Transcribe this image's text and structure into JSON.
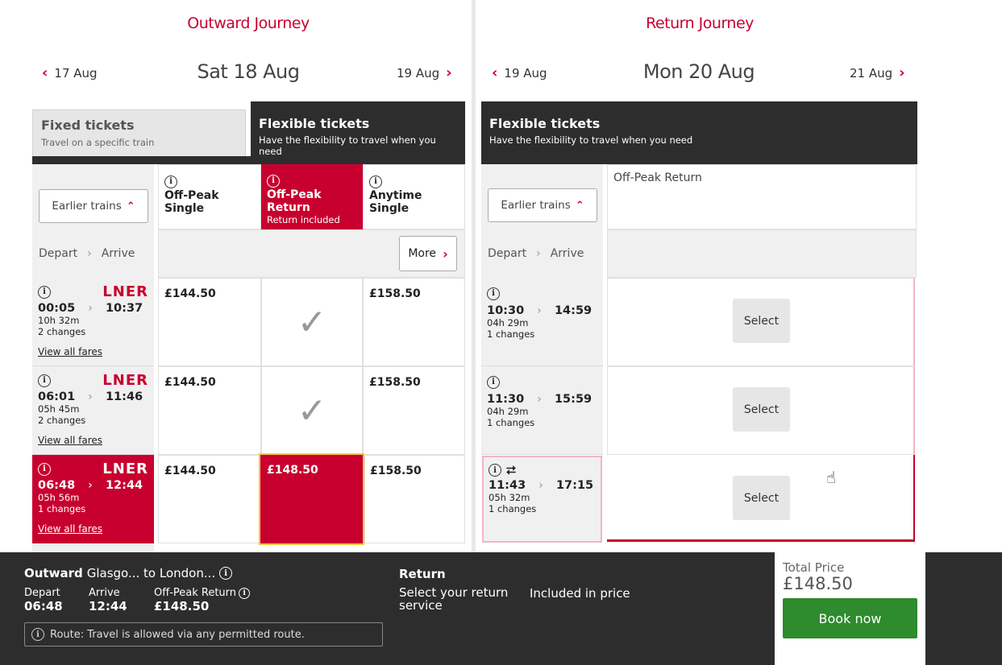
{
  "outward": {
    "title": "Outward Journey",
    "prev_date": "17 Aug",
    "current_date": "Sat 18 Aug",
    "next_date": "19 Aug",
    "tabs": {
      "fixed_title": "Fixed tickets",
      "fixed_sub": "Travel on a specific train",
      "flex_title": "Flexible tickets",
      "flex_sub": "Have the flexibility to travel when you need"
    },
    "earlier_label": "Earlier trains",
    "depart_label": "Depart",
    "arrive_label": "Arrive",
    "more_label": "More",
    "fares": [
      {
        "name": "Off-Peak Single",
        "sub": ""
      },
      {
        "name": "Off-Peak Return",
        "sub": "Return included"
      },
      {
        "name": "Anytime Single",
        "sub": ""
      }
    ],
    "trains": [
      {
        "operator": "LNER",
        "depart": "00:05",
        "arrive": "10:37",
        "duration": "10h 32m",
        "changes": "2 changes",
        "view_fares": "View all fares",
        "p1": "£144.50",
        "p3": "£158.50"
      },
      {
        "operator": "LNER",
        "depart": "06:01",
        "arrive": "11:46",
        "duration": "05h 45m",
        "changes": "2 changes",
        "view_fares": "View all fares",
        "p1": "£144.50",
        "p3": "£158.50"
      },
      {
        "operator": "LNER",
        "depart": "06:48",
        "arrive": "12:44",
        "duration": "05h 56m",
        "changes": "1 changes",
        "view_fares": "View all fares",
        "p1": "£144.50",
        "p2": "£148.50",
        "p3": "£158.50"
      }
    ]
  },
  "return": {
    "title": "Return Journey",
    "prev_date": "19 Aug",
    "current_date": "Mon 20 Aug",
    "next_date": "21 Aug",
    "flex_title": "Flexible tickets",
    "flex_sub": "Have the flexibility to travel when you need",
    "fare_name": "Off-Peak Return",
    "earlier_label": "Earlier trains",
    "depart_label": "Depart",
    "arrive_label": "Arrive",
    "select_label": "Select",
    "trains": [
      {
        "depart": "10:30",
        "arrive": "14:59",
        "duration": "04h 29m",
        "changes": "1 changes"
      },
      {
        "depart": "11:30",
        "arrive": "15:59",
        "duration": "04h 29m",
        "changes": "1 changes"
      },
      {
        "depart": "11:43",
        "arrive": "17:15",
        "duration": "05h 32m",
        "changes": "1 changes"
      }
    ]
  },
  "footer": {
    "outward_bold": "Outward",
    "outward_route": "Glasgo... to London...",
    "depart_label": "Depart",
    "depart_time": "06:48",
    "arrive_label": "Arrive",
    "arrive_time": "12:44",
    "fare_label": "Off-Peak Return",
    "fare_price": "£148.50",
    "route_note": "Route: Travel is allowed via any permitted route.",
    "return_title": "Return",
    "return_msg": "Select your return service",
    "included": "Included in price",
    "total_label": "Total Price",
    "total_value": "£148.50",
    "book_label": "Book now"
  },
  "colors": {
    "brand_red": "#c8002f",
    "dark": "#2d2d2d",
    "book_green": "#2e8b2e",
    "highlight": "#f4c542"
  }
}
